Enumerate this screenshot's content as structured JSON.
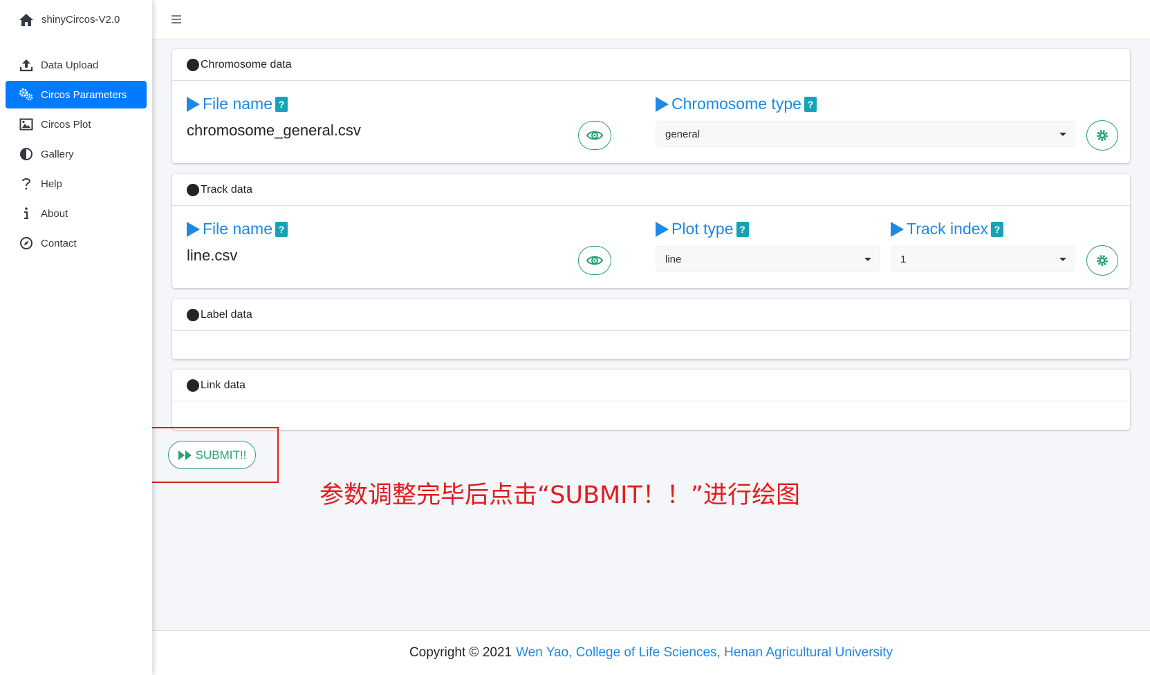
{
  "app": {
    "title": "shinyCircos-V2.0"
  },
  "sidebar": {
    "items": [
      {
        "label": "Data Upload",
        "icon": "upload-icon",
        "active": false
      },
      {
        "label": "Circos Parameters",
        "icon": "cogs-icon",
        "active": true
      },
      {
        "label": "Circos Plot",
        "icon": "image-icon",
        "active": false
      },
      {
        "label": "Gallery",
        "icon": "adjust-icon",
        "active": false
      },
      {
        "label": "Help",
        "icon": "question-icon",
        "active": false
      },
      {
        "label": "About",
        "icon": "info-icon",
        "active": false
      },
      {
        "label": "Contact",
        "icon": "compass-icon",
        "active": false
      }
    ]
  },
  "chromosome": {
    "header": "Chromosome data",
    "file_label": "File name",
    "file_value": "chromosome_general.csv",
    "type_label": "Chromosome type",
    "type_value": "general"
  },
  "track": {
    "header": "Track data",
    "file_label": "File name",
    "file_value": "line.csv",
    "plot_type_label": "Plot type",
    "plot_type_value": "line",
    "track_index_label": "Track index",
    "track_index_value": "1"
  },
  "label_data": {
    "header": "Label data"
  },
  "link_data": {
    "header": "Link data"
  },
  "submit": {
    "label": "SUBMIT!!"
  },
  "annotation": {
    "text": "参数调整完毕后点击“SUBMIT！！”进行绘图"
  },
  "footer": {
    "prefix": "Copyright © 2021",
    "link": "Wen Yao, College of Life Sciences, Henan Agricultural University"
  },
  "colors": {
    "primary": "#007bff",
    "accent_green": "#28a06f",
    "label_blue": "#1e88e5",
    "help_badge": "#17a2b8",
    "annotation_red": "#e31c1c"
  }
}
